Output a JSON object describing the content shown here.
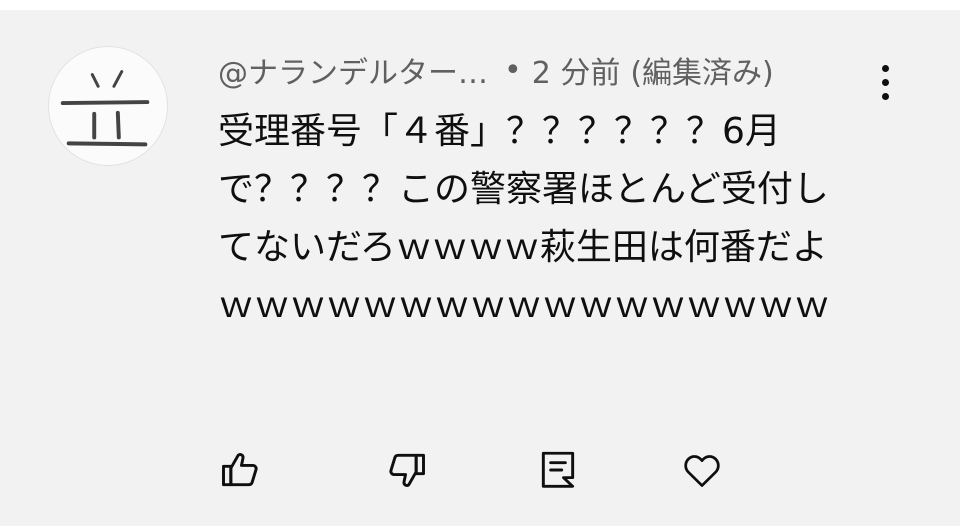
{
  "comment": {
    "author": "@ナランデルター…",
    "separator": "•",
    "time": "2 分前",
    "edited": "(編集済み)",
    "body": "受理番号「４番」？？？？？？6月で？？？？この警察署ほとんど受付してないだろｗｗｗｗ萩生田は何番だよｗｗｗｗｗｗｗｗｗｗｗｗｗｗｗｗｗ",
    "avatar_icon": "handwritten-kanji-avatar",
    "menu_icon": "three-dots-vertical-icon"
  },
  "actions": [
    {
      "icon": "thumbs-up-icon"
    },
    {
      "icon": "thumbs-down-icon"
    },
    {
      "icon": "reply-icon"
    },
    {
      "icon": "heart-icon"
    }
  ],
  "colors": {
    "background": "#f2f2f2",
    "text": "#0f0f0f",
    "meta_text": "#606060"
  }
}
